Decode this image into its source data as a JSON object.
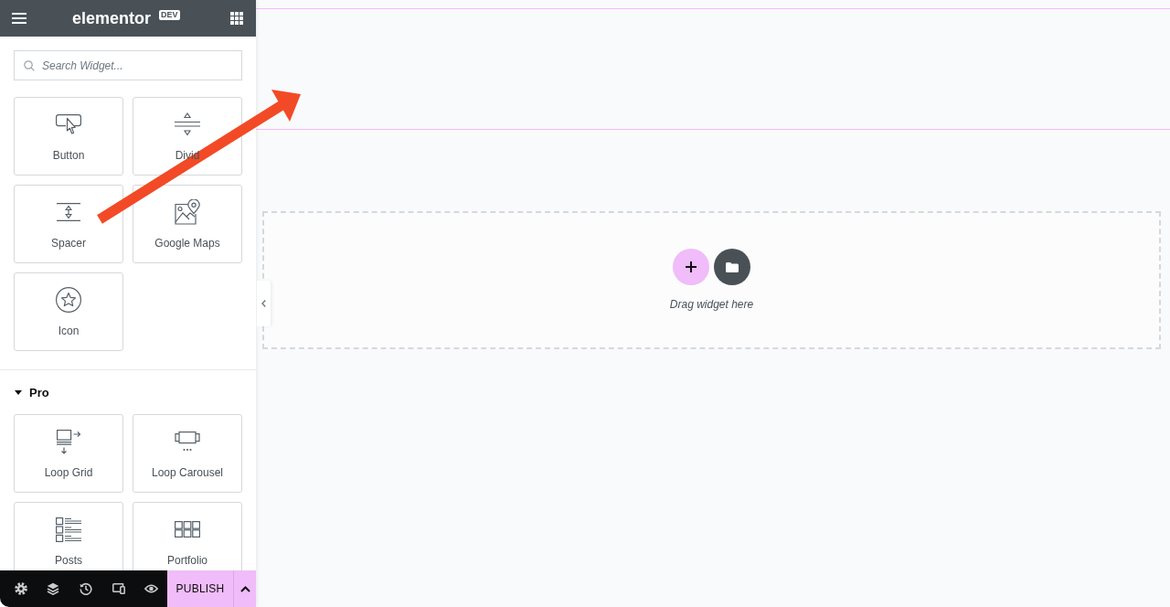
{
  "panel": {
    "header": {
      "logo": "elementor",
      "badge": "DEV"
    },
    "search": {
      "placeholder": "Search Widget..."
    },
    "groups": [
      {
        "widgets": [
          {
            "kind": "button",
            "label": "Button"
          },
          {
            "kind": "divider",
            "label": "Divid"
          },
          {
            "kind": "spacer",
            "label": "Spacer"
          },
          {
            "kind": "map",
            "label": "Google Maps"
          },
          {
            "kind": "icon",
            "label": "Icon"
          }
        ]
      },
      {
        "title": "Pro",
        "expanded": true,
        "widgets": [
          {
            "kind": "loop-grid",
            "label": "Loop Grid"
          },
          {
            "kind": "loop-carousel",
            "label": "Loop Carousel"
          },
          {
            "kind": "posts",
            "label": "Posts"
          },
          {
            "kind": "portfolio",
            "label": "Portfolio"
          }
        ]
      }
    ],
    "footer": {
      "publish": "PUBLISH"
    }
  },
  "canvas": {
    "drop_zone": {
      "hint": "Drag widget here"
    }
  }
}
